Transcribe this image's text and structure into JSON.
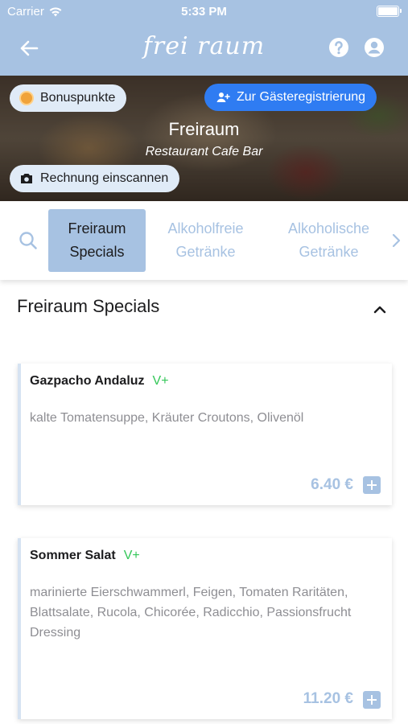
{
  "status": {
    "carrier": "Carrier",
    "time": "5:33 PM"
  },
  "nav": {
    "logo": "frei raum"
  },
  "hero": {
    "bonus_label": "Bonuspunkte",
    "guest_label": "Zur Gästeregistrierung",
    "title": "Freiraum",
    "subtitle": "Restaurant Cafe Bar",
    "scan_label": "Rechnung einscannen"
  },
  "categories": [
    {
      "line1": "Freiraum",
      "line2": "Specials",
      "active": true
    },
    {
      "line1": "Alkoholfreie",
      "line2": "Getränke",
      "active": false
    },
    {
      "line1": "Alkoholische",
      "line2": "Getränke",
      "active": false
    }
  ],
  "section": {
    "title": "Freiraum Specials"
  },
  "items": [
    {
      "name": "Gazpacho Andaluz",
      "badge": "V+",
      "description": "kalte Tomatensuppe, Kräuter Croutons, Olivenöl",
      "price": "6.40 €"
    },
    {
      "name": "Sommer Salat",
      "badge": "V+",
      "description": "marinierte Eierschwammerl, Feigen, Tomaten Raritäten, Blattsalate, Rucola, Chicorée, Radicchio, Passionsfrucht Dressing",
      "price": "11.20 €"
    }
  ],
  "colors": {
    "accent": "#a7c2e2",
    "primary_button": "#2f7cf2",
    "veg_badge": "#34c759"
  }
}
